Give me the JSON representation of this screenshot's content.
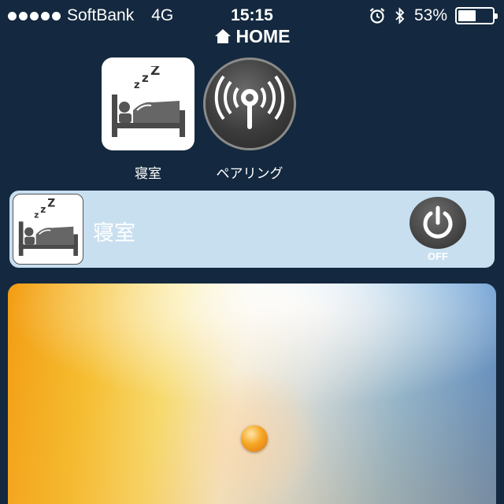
{
  "status_bar": {
    "carrier": "SoftBank",
    "network": "4G",
    "time": "15:15",
    "battery_percent_label": "53%",
    "battery_level": 0.53,
    "icons": [
      "signal-dots-icon",
      "alarm-icon",
      "bluetooth-icon",
      "battery-icon"
    ]
  },
  "header": {
    "title": "HOME",
    "icon": "home-icon"
  },
  "tiles": [
    {
      "label": "寝室",
      "icon": "bedroom-sleep-icon"
    },
    {
      "label": "ペアリング",
      "icon": "wifi-pairing-icon"
    }
  ],
  "room": {
    "name": "寝室",
    "icon": "bedroom-sleep-icon",
    "power_icon": "power-icon",
    "power_state": "OFF"
  },
  "colors": {
    "background": "#14293f",
    "room_bar": "#c8dff0",
    "knob": "#f5a521"
  }
}
